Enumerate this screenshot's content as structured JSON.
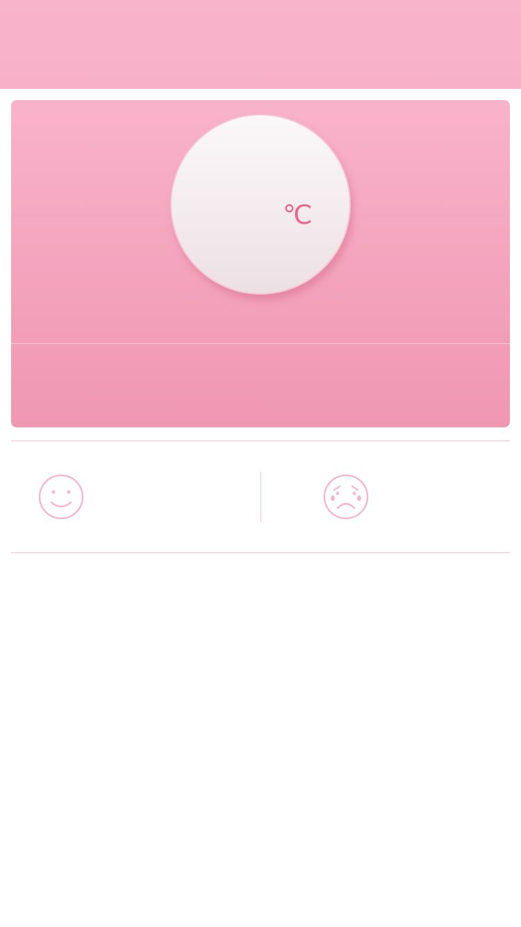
{
  "temperature": {
    "value": "",
    "unit": "℃"
  },
  "moods": [
    {
      "icon": "smile-icon",
      "label": ""
    },
    {
      "icon": "sad-face-icon",
      "label": ""
    }
  ],
  "colors": {
    "accent": "#e9668d",
    "header": "#f8b4cb",
    "divider": "#f3bfd0"
  }
}
